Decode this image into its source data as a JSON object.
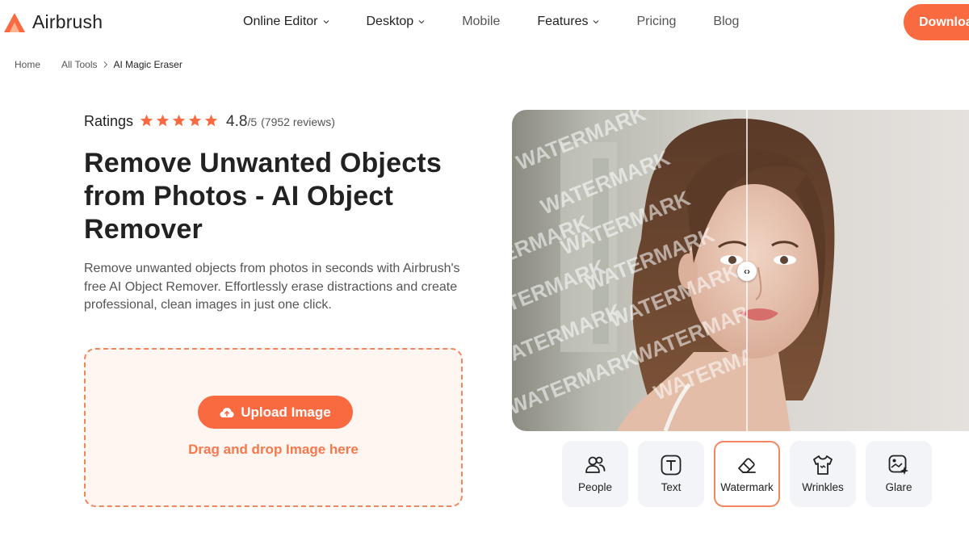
{
  "header": {
    "brand": "Airbrush",
    "nav": [
      {
        "label": "Online Editor",
        "dropdown": true
      },
      {
        "label": "Desktop",
        "dropdown": true
      },
      {
        "label": "Mobile",
        "dropdown": false
      },
      {
        "label": "Features",
        "dropdown": true
      },
      {
        "label": "Pricing",
        "dropdown": false
      },
      {
        "label": "Blog",
        "dropdown": false
      }
    ],
    "download_label": "Download"
  },
  "breadcrumb": {
    "items": [
      "Home",
      "All Tools",
      "AI Magic Eraser"
    ]
  },
  "hero": {
    "ratings_label": "Ratings",
    "stars": 5,
    "score": "4.8",
    "score_den": "/5",
    "reviews": "(7952 reviews)",
    "title": "Remove Unwanted Objects from Photos - AI Object Remover",
    "description": "Remove unwanted objects from photos in seconds with Airbrush's free AI Object Remover. Effortlessly erase distractions and create professional, clean images in just one click.",
    "upload_label": "Upload Image",
    "drag_text": "Drag and drop Image here"
  },
  "compare": {
    "watermark_text": "WATERMARK",
    "handle_glyph": "‹›"
  },
  "tools": [
    {
      "label": "People",
      "icon": "people-icon",
      "active": false
    },
    {
      "label": "Text",
      "icon": "text-icon",
      "active": false
    },
    {
      "label": "Watermark",
      "icon": "eraser-icon",
      "active": true
    },
    {
      "label": "Wrinkles",
      "icon": "shirt-icon",
      "active": false
    },
    {
      "label": "Glare",
      "icon": "glare-icon",
      "active": false
    }
  ],
  "colors": {
    "accent": "#f96a41",
    "dropzone_bg": "#fff5f1",
    "tile_bg": "#f2f4f8"
  }
}
